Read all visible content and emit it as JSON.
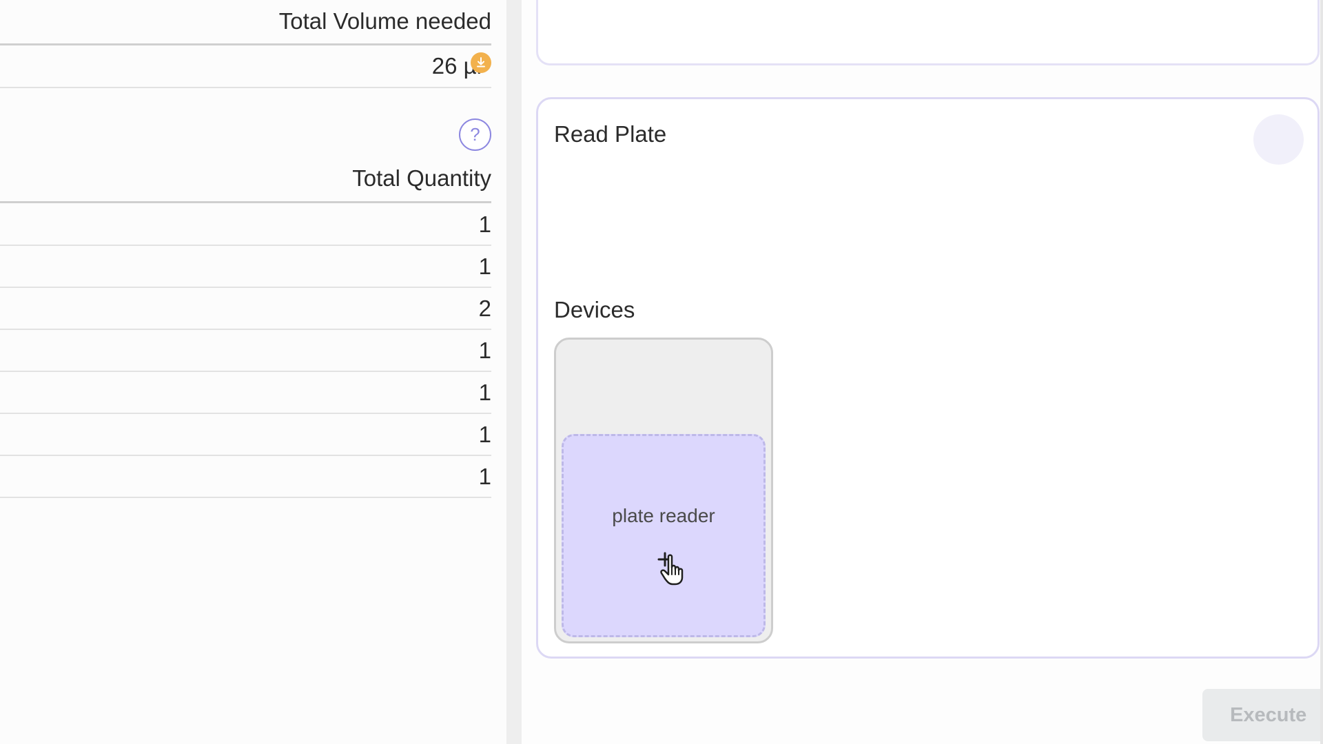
{
  "volume_table": {
    "header": "Total Volume needed",
    "value": "26 µl",
    "info_icon": "download-icon",
    "info_color": "#f2b14d"
  },
  "help_button": {
    "icon": "question-icon",
    "label": "?"
  },
  "quantity_table": {
    "header": "Total Quantity",
    "rows": [
      "1",
      "1",
      "2",
      "1",
      "1",
      "1",
      "1"
    ]
  },
  "step_card": {
    "title": "Read Plate",
    "devices_label": "Devices",
    "device_name": "plate reader",
    "accent": "#dcd7fd"
  },
  "actions": {
    "execute_label": "Execute"
  }
}
